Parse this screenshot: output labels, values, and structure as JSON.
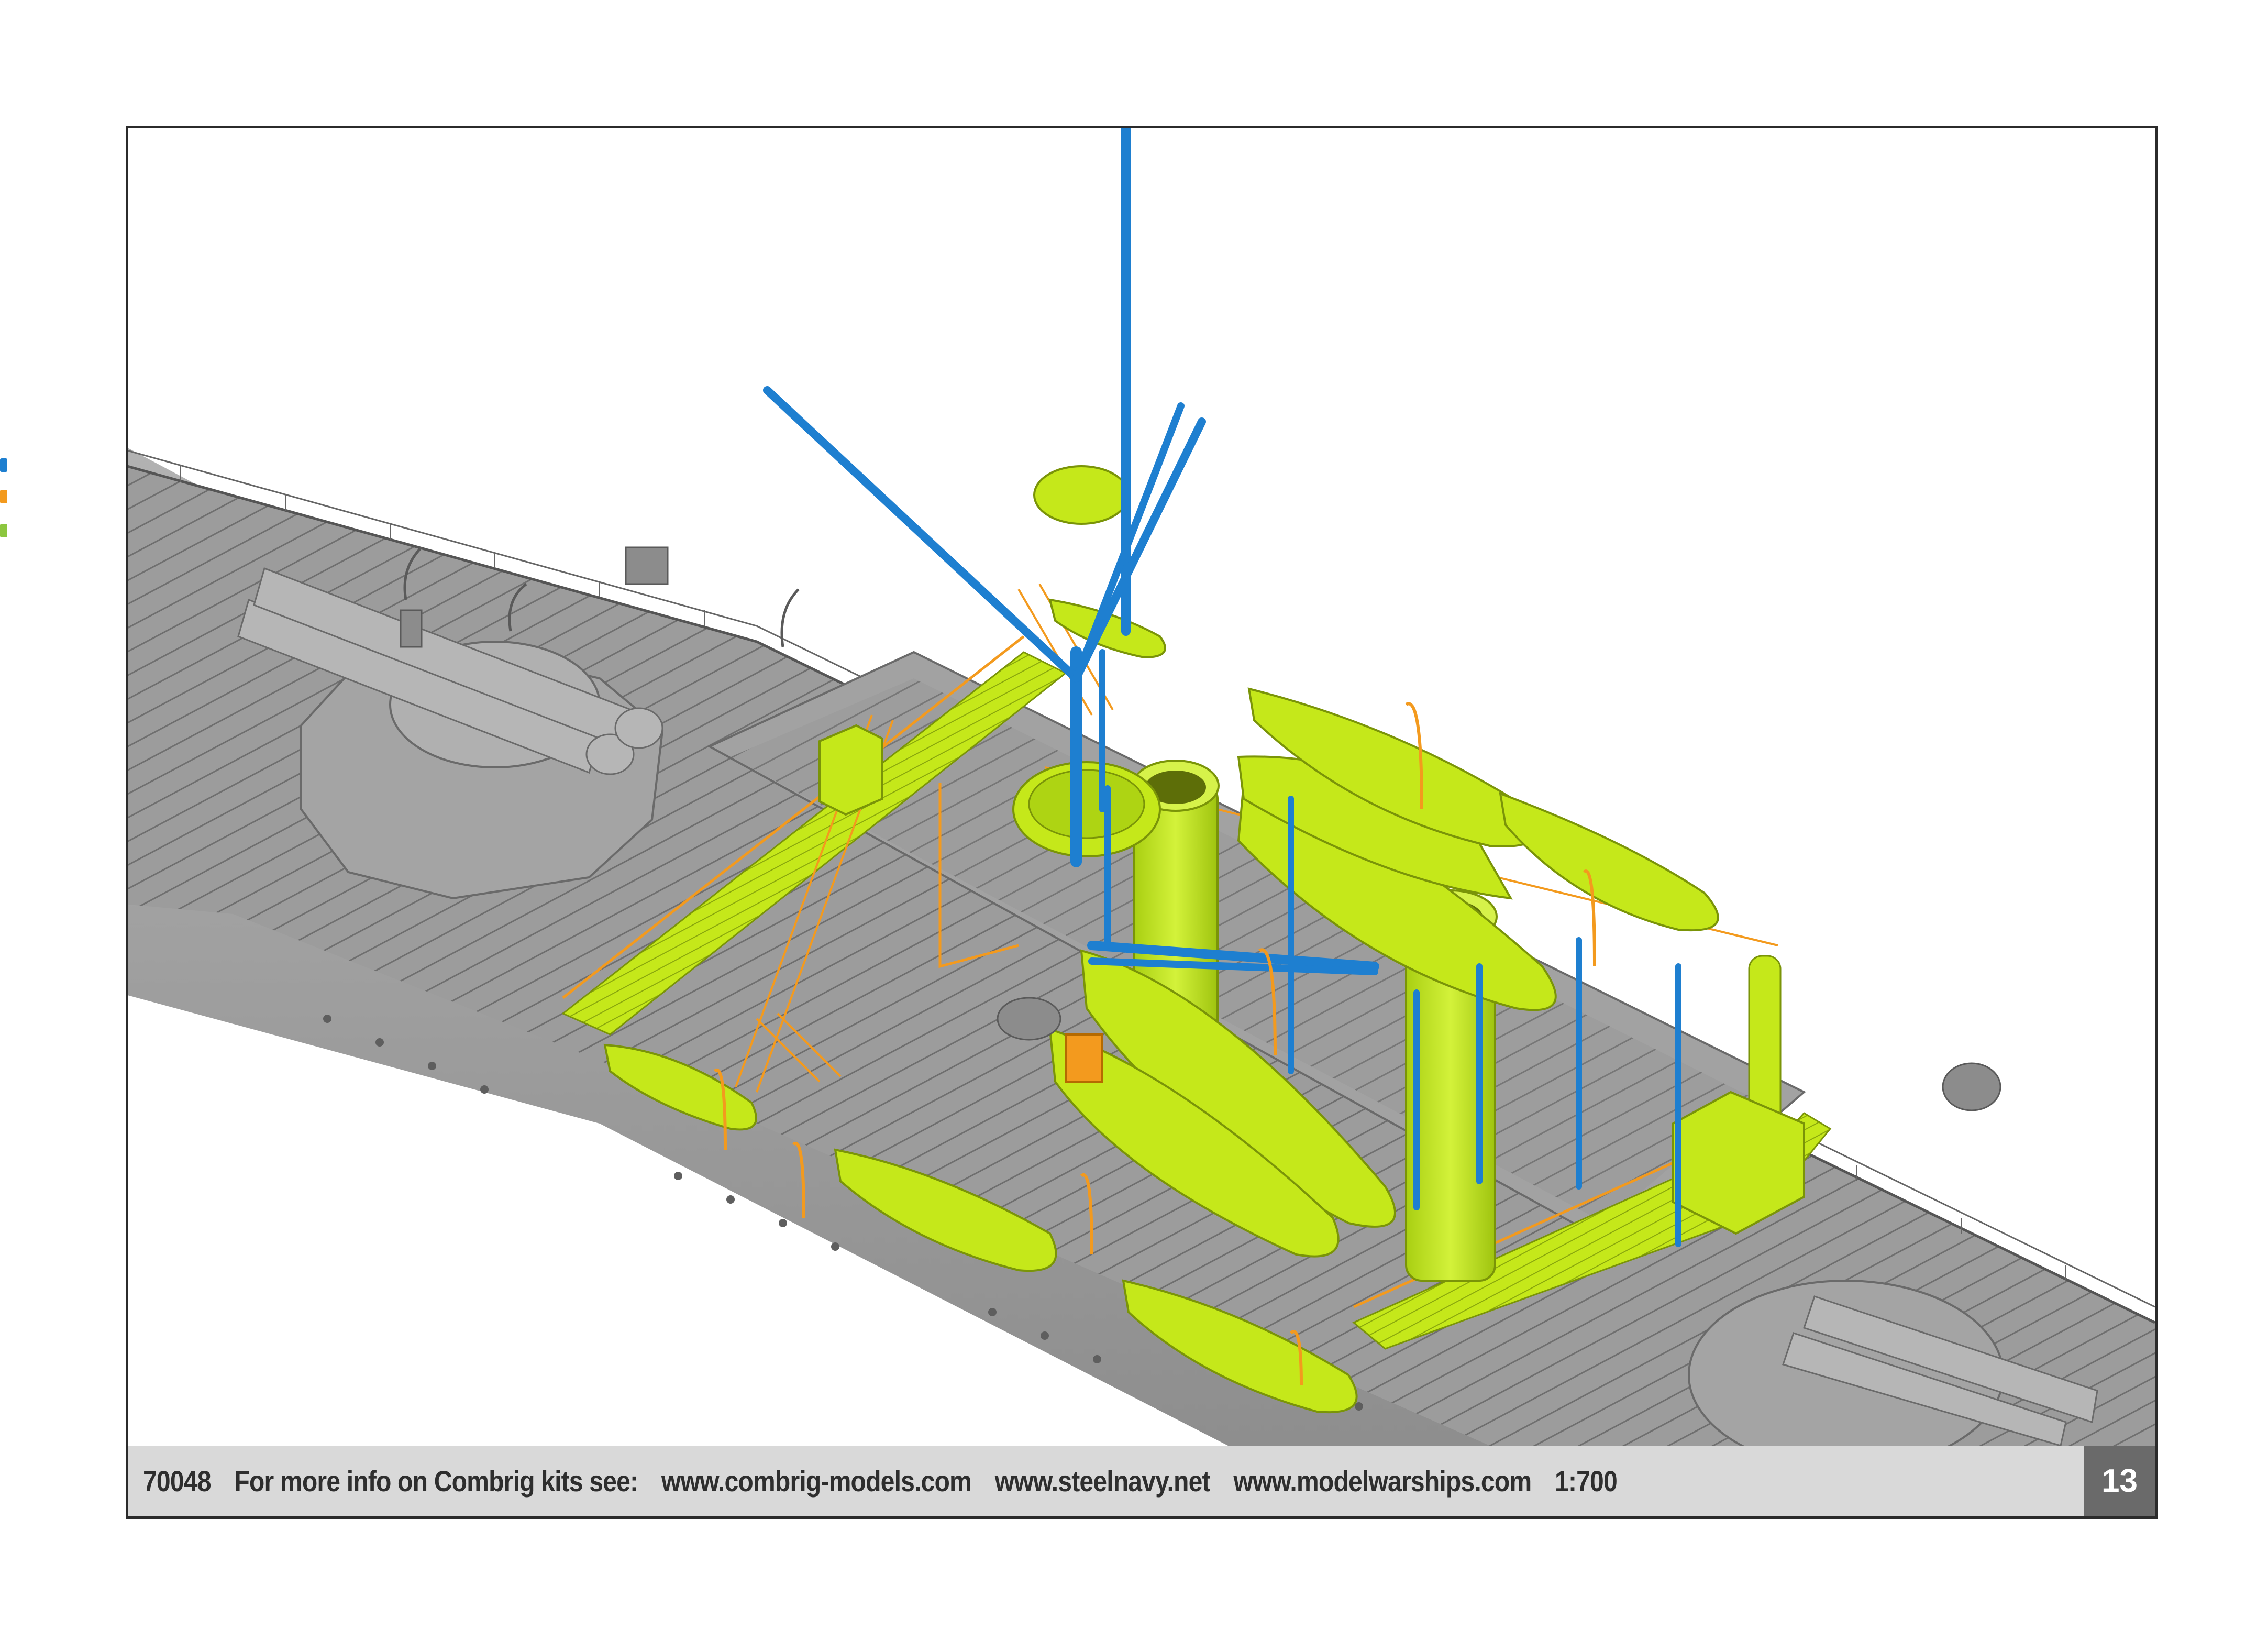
{
  "footer": {
    "kit_number": "70048",
    "info_label": "For more info on Combrig kits see:",
    "website_1": "www.combrig-models.com",
    "website_2": "www.steelnavy.net",
    "website_3": "www.modelwarships.com",
    "scale": "1:700",
    "page_number": "13"
  },
  "colors": {
    "hull_grey": "#a8a8a8",
    "deck_grey": "#9a9a9a",
    "highlight_green": "#c5e81a",
    "mast_blue": "#1e7fd0",
    "railing_orange": "#f39a1e",
    "footer_bg": "#d9d9d9",
    "page_num_bg": "#6a6a6a"
  }
}
